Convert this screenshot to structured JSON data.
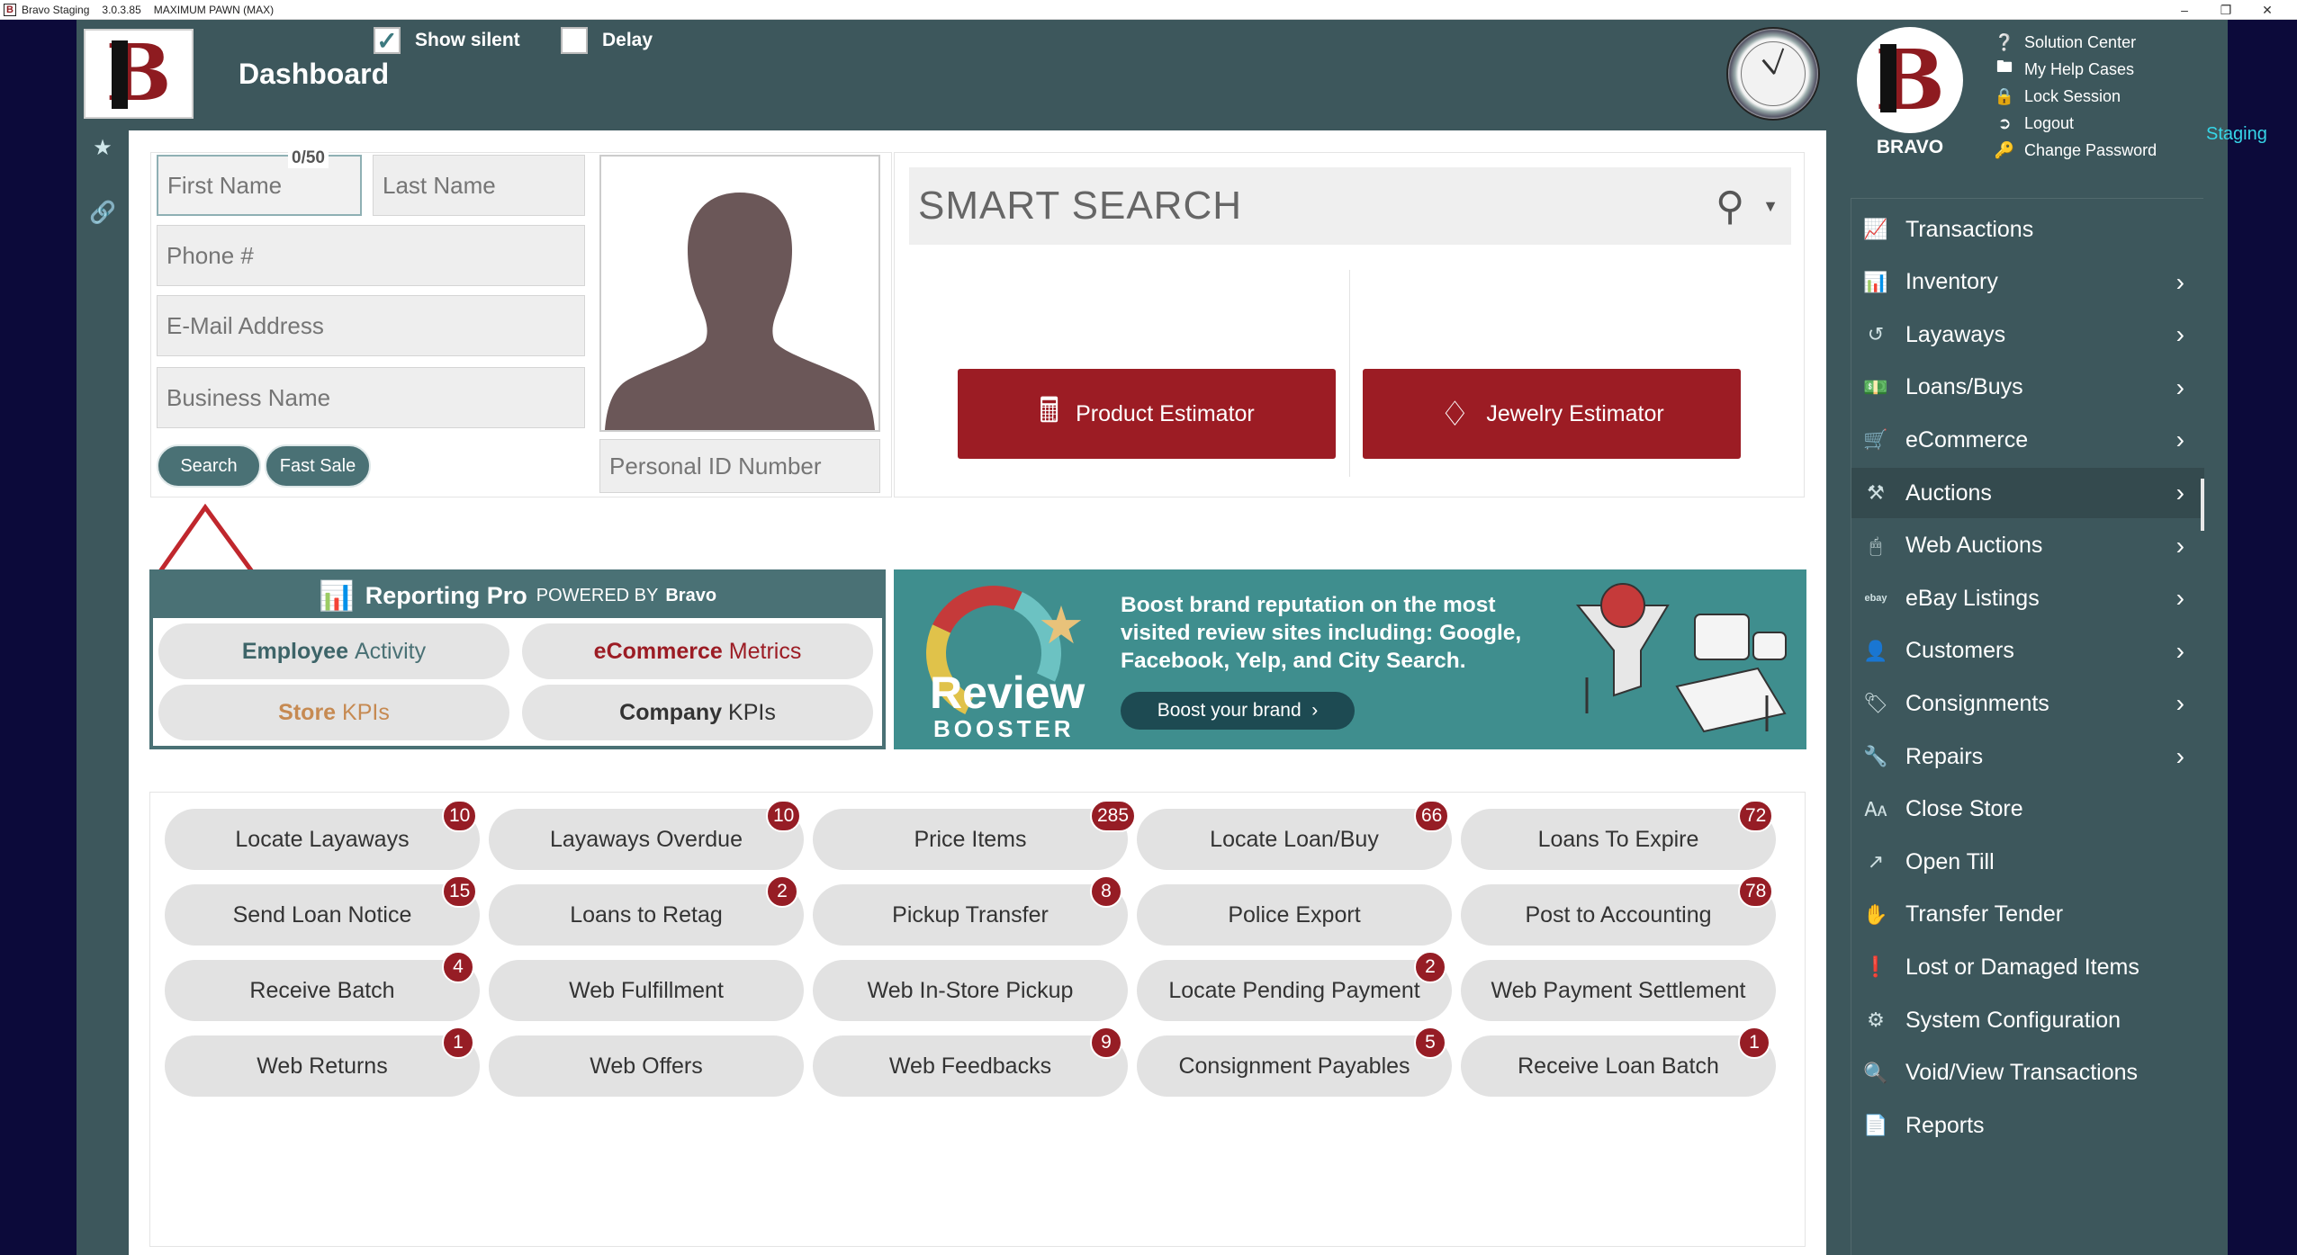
{
  "titlebar": {
    "app_name": "Bravo Staging",
    "version": "3.0.3.85",
    "store": "MAXIMUM PAWN (MAX)"
  },
  "header": {
    "title": "Dashboard",
    "show_silent_label": "Show silent",
    "show_silent_checked": true,
    "delay_label": "Delay",
    "delay_checked": false,
    "brand_label": "BRAVO",
    "staging_label": "Staging",
    "user_links": [
      {
        "label": "Solution Center",
        "icon": "question-circle-icon"
      },
      {
        "label": "My Help Cases",
        "icon": "folder-icon"
      },
      {
        "label": "Lock Session",
        "icon": "lock-icon"
      },
      {
        "label": "Logout",
        "icon": "logout-icon"
      },
      {
        "label": "Change Password",
        "icon": "key-icon"
      }
    ]
  },
  "customer_form": {
    "first_name_placeholder": "First Name",
    "first_name_counter": "0/50",
    "last_name_placeholder": "Last Name",
    "phone_placeholder": "Phone #",
    "email_placeholder": "E-Mail Address",
    "business_placeholder": "Business Name",
    "personal_id_placeholder": "Personal ID Number",
    "search_button": "Search",
    "fast_sale_button": "Fast Sale"
  },
  "smart_search": {
    "placeholder": "SMART SEARCH",
    "product_estimator": "Product Estimator",
    "jewelry_estimator": "Jewelry Estimator"
  },
  "reporting_pro": {
    "title": "Reporting Pro",
    "powered_by": "POWERED BY",
    "brand": "Bravo",
    "employee_activity": {
      "a": "Employee",
      "b": "Activity"
    },
    "ecommerce_metrics": {
      "a": "eCommerce",
      "b": "Metrics"
    },
    "store_kpis": {
      "a": "Store",
      "b": "KPIs"
    },
    "company_kpis": {
      "a": "Company",
      "b": "KPIs"
    }
  },
  "banner": {
    "line1": "Review",
    "line2": "BOOSTER",
    "copy": "Boost brand reputation on the most visited review sites including: Google, Facebook, Yelp, and City Search.",
    "cta": "Boost your brand"
  },
  "quick_actions": [
    [
      {
        "label": "Locate Layaways",
        "badge": "10"
      },
      {
        "label": "Layaways Overdue",
        "badge": "10"
      },
      {
        "label": "Price Items",
        "badge": "285"
      },
      {
        "label": "Locate Loan/Buy",
        "badge": "66"
      },
      {
        "label": "Loans To Expire",
        "badge": "72"
      }
    ],
    [
      {
        "label": "Send Loan Notice",
        "badge": "15"
      },
      {
        "label": "Loans to Retag",
        "badge": "2"
      },
      {
        "label": "Pickup Transfer",
        "badge": "8"
      },
      {
        "label": "Police Export",
        "badge": ""
      },
      {
        "label": "Post to Accounting",
        "badge": "78"
      }
    ],
    [
      {
        "label": "Receive Batch",
        "badge": "4"
      },
      {
        "label": "Web Fulfillment",
        "badge": ""
      },
      {
        "label": "Web In-Store Pickup",
        "badge": ""
      },
      {
        "label": "Locate Pending Payment",
        "badge": "2"
      },
      {
        "label": "Web Payment Settlement",
        "badge": ""
      }
    ],
    [
      {
        "label": "Web Returns",
        "badge": "1"
      },
      {
        "label": "Web Offers",
        "badge": ""
      },
      {
        "label": "Web Feedbacks",
        "badge": "9"
      },
      {
        "label": "Consignment Payables",
        "badge": "5"
      },
      {
        "label": "Receive Loan Batch",
        "badge": "1"
      }
    ]
  ],
  "nav": [
    {
      "label": "Transactions",
      "icon": "chart-icon",
      "chevron": false
    },
    {
      "label": "Inventory",
      "icon": "inventory-icon",
      "chevron": true
    },
    {
      "label": "Layaways",
      "icon": "history-icon",
      "chevron": true
    },
    {
      "label": "Loans/Buys",
      "icon": "money-icon",
      "chevron": true
    },
    {
      "label": "eCommerce",
      "icon": "cart-icon",
      "chevron": true
    },
    {
      "label": "Auctions",
      "icon": "gavel-icon",
      "chevron": true,
      "active": true
    },
    {
      "label": "Web Auctions",
      "icon": "mouse-icon",
      "chevron": true
    },
    {
      "label": "eBay Listings",
      "icon": "ebay-icon",
      "chevron": true
    },
    {
      "label": "Customers",
      "icon": "user-icon",
      "chevron": true
    },
    {
      "label": "Consignments",
      "icon": "tag-icon",
      "chevron": true
    },
    {
      "label": "Repairs",
      "icon": "wrench-icon",
      "chevron": true
    },
    {
      "label": "Close Store",
      "icon": "close-store-icon",
      "chevron": false
    },
    {
      "label": "Open Till",
      "icon": "open-external-icon",
      "chevron": false
    },
    {
      "label": "Transfer Tender",
      "icon": "hand-money-icon",
      "chevron": false
    },
    {
      "label": "Lost or Damaged Items",
      "icon": "alert-icon",
      "chevron": false
    },
    {
      "label": "System Configuration",
      "icon": "cogs-icon",
      "chevron": false
    },
    {
      "label": "Void/View Transactions",
      "icon": "search-doc-icon",
      "chevron": false
    },
    {
      "label": "Reports",
      "icon": "file-icon",
      "chevron": false
    }
  ],
  "colors": {
    "frame": "#3d575c",
    "accent_teal": "#4a7175",
    "brand_red": "#9c1c24",
    "badge_red": "#961d25",
    "staging": "#36d6e8"
  }
}
